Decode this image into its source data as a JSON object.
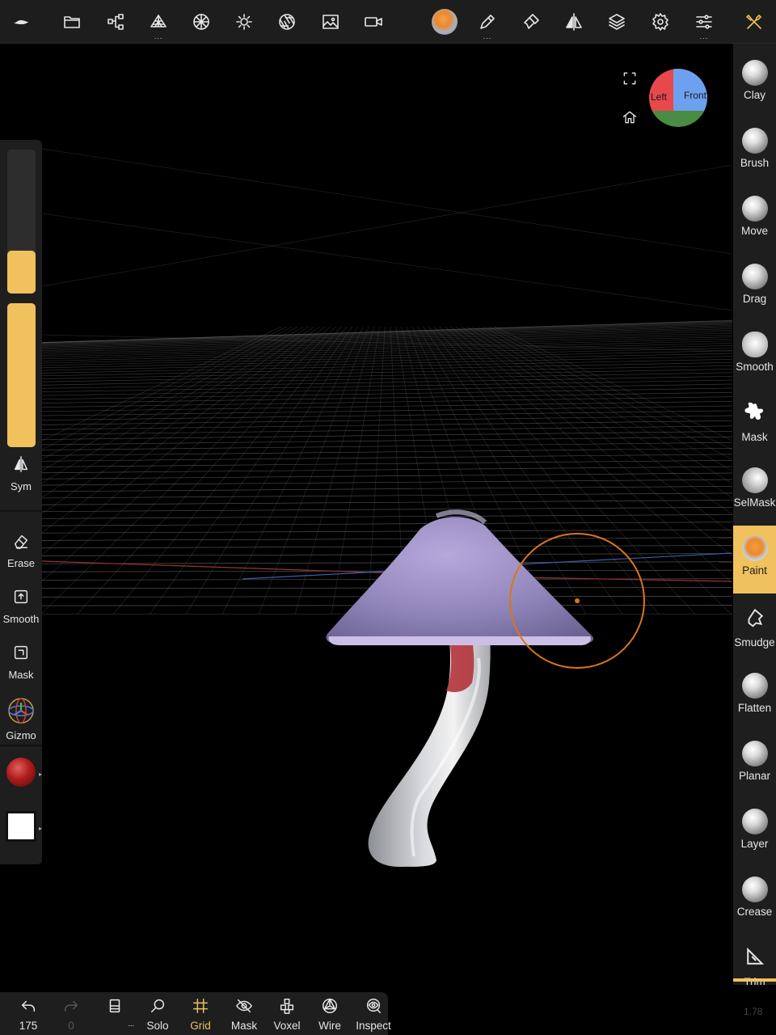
{
  "toolbar": {
    "icons": [
      "nomad-logo-icon",
      "folder-icon",
      "scene-graph-icon",
      "topology-icon",
      "material-sphere-icon",
      "light-icon",
      "aperture-icon",
      "background-image-icon",
      "camera-icon",
      "paint-material-icon",
      "stroke-pen-icon",
      "brush-settings-icon",
      "symmetry-icon",
      "layers-icon",
      "settings-icon",
      "sliders-icon",
      "tools-icon"
    ],
    "active_tool": "tools-icon"
  },
  "viewport": {
    "navcube": {
      "left_label": "Left",
      "front_label": "Front"
    },
    "cursor_color": "#d9761a"
  },
  "left_panel": {
    "sym_label": "Sym",
    "erase_label": "Erase",
    "smooth_label": "Smooth",
    "mask_label": "Mask",
    "gizmo_label": "Gizmo",
    "radius_level": 0.3,
    "intensity_level": 1.0,
    "accent_color": "#f0c15c",
    "paint_color": "#b01c1c",
    "secondary_color": "#ffffff"
  },
  "brushes": [
    {
      "label": "Clay"
    },
    {
      "label": "Brush"
    },
    {
      "label": "Move"
    },
    {
      "label": "Drag"
    },
    {
      "label": "Smooth"
    },
    {
      "label": "Mask"
    },
    {
      "label": "SelMask"
    },
    {
      "label": "Paint",
      "active": true
    },
    {
      "label": "Smudge"
    },
    {
      "label": "Flatten"
    },
    {
      "label": "Planar"
    },
    {
      "label": "Layer"
    },
    {
      "label": "Crease"
    },
    {
      "label": "Trim"
    }
  ],
  "bottom_bar": {
    "undo_count": "175",
    "redo_count": "0",
    "items": [
      {
        "label": "Solo"
      },
      {
        "label": "Grid",
        "active": true
      },
      {
        "label": "Mask"
      },
      {
        "label": "Voxel"
      },
      {
        "label": "Wire"
      },
      {
        "label": "Inspect"
      }
    ]
  },
  "version": "1.78"
}
